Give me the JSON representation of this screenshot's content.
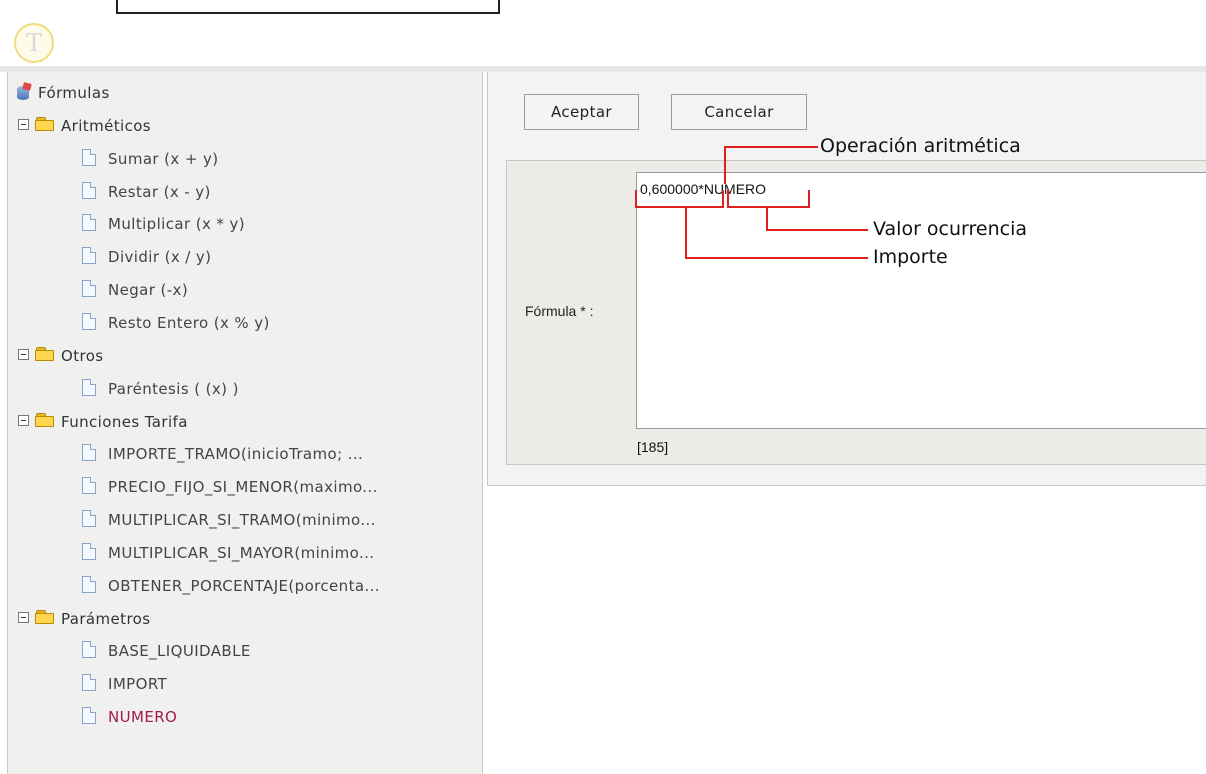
{
  "tree": {
    "root_label": "Fórmulas",
    "groups": [
      {
        "label": "Aritméticos",
        "items": [
          "Sumar (x + y)",
          "Restar (x - y)",
          "Multiplicar (x * y)",
          "Dividir (x / y)",
          "Negar (-x)",
          "Resto Entero (x % y)"
        ]
      },
      {
        "label": "Otros",
        "items": [
          "Paréntesis ( (x) )"
        ]
      },
      {
        "label": "Funciones Tarifa",
        "items": [
          "IMPORTE_TRAMO(inicioTramo; ...",
          "PRECIO_FIJO_SI_MENOR(maximo...",
          "MULTIPLICAR_SI_TRAMO(minimo...",
          "MULTIPLICAR_SI_MAYOR(minimo...",
          "OBTENER_PORCENTAJE(porcenta..."
        ]
      },
      {
        "label": "Parámetros",
        "items": [
          "BASE_LIQUIDABLE",
          "IMPORT",
          "NUMERO"
        ]
      }
    ],
    "selected_item": "NUMERO"
  },
  "toolbar": {
    "accept_label": "Aceptar",
    "cancel_label": "Cancelar"
  },
  "form": {
    "formula_label": "Fórmula * :",
    "formula_value": "0,600000*NUMERO",
    "char_counter": "[185]"
  },
  "annotations": {
    "operation": "Operación aritmética",
    "occurrence": "Valor ocurrencia",
    "amount": "Importe"
  },
  "colors": {
    "annotation_line": "#e02020",
    "selected_item": "#a01c4c",
    "logo_ring": "#f2dc78"
  }
}
